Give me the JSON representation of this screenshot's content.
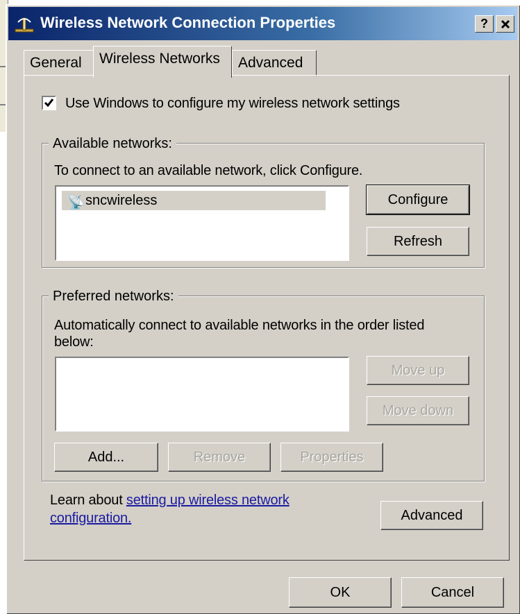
{
  "window": {
    "title": "Wireless Network Connection Properties",
    "help_button": "?",
    "close_button": "✕"
  },
  "tabs": [
    {
      "label": "General",
      "active": false
    },
    {
      "label": "Wireless Networks",
      "active": true
    },
    {
      "label": "Advanced",
      "active": false
    }
  ],
  "use_windows": {
    "label": "Use Windows to configure my wireless network settings",
    "checked": true
  },
  "available": {
    "group_label": "Available networks:",
    "description": "To connect to an available network, click Configure.",
    "networks": [
      "sncwireless"
    ],
    "configure_button": "Configure",
    "refresh_button": "Refresh"
  },
  "preferred": {
    "group_label": "Preferred networks:",
    "description_line1": "Automatically connect to available networks in the order listed",
    "description_line2": "below:",
    "move_up_button": "Move up",
    "move_down_button": "Move down",
    "add_button": "Add...",
    "remove_button": "Remove",
    "properties_button": "Properties"
  },
  "learn": {
    "prefix": "Learn about ",
    "link_line1": "setting up wireless network",
    "link_line2": "configuration."
  },
  "advanced_button": "Advanced",
  "ok_button": "OK",
  "cancel_button": "Cancel",
  "colors": {
    "titlebar_start": "#0a246a",
    "titlebar_end": "#a6caf0",
    "face": "#d4d0c8",
    "link": "#1a1aa0"
  }
}
